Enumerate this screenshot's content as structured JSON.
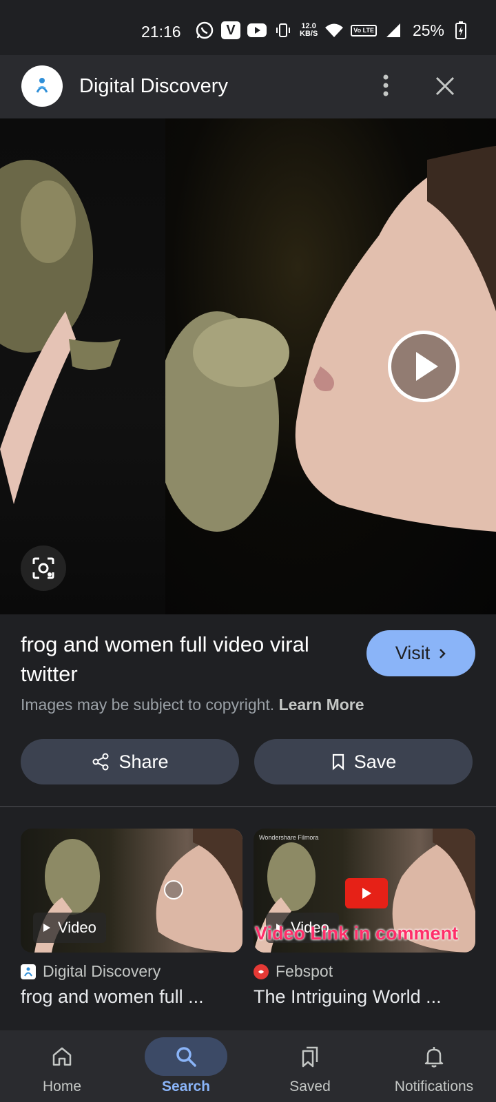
{
  "status_bar": {
    "time": "21:16",
    "net_speed_value": "12.0",
    "net_speed_unit": "KB/S",
    "volte": "Vo LTE",
    "battery": "25%"
  },
  "header": {
    "site_name": "Digital Discovery"
  },
  "details": {
    "title": "frog and women full video viral twitter",
    "visit_label": "Visit",
    "copyright_text": "Images may be subject to copyright.",
    "learn_more": "Learn More",
    "share_label": "Share",
    "save_label": "Save"
  },
  "related": [
    {
      "chip": "Video",
      "source": "Digital Discovery",
      "title": "frog and women full ..."
    },
    {
      "chip": "Video",
      "watermark": "Wondershare Filmora",
      "overlay": "Video Link in comment",
      "source": "Febspot",
      "title": "The Intriguing World ..."
    }
  ],
  "bottom_nav": [
    {
      "label": "Home",
      "icon": "home-icon"
    },
    {
      "label": "Search",
      "icon": "search-icon",
      "active": true
    },
    {
      "label": "Saved",
      "icon": "bookmarks-icon"
    },
    {
      "label": "Notifications",
      "icon": "bell-icon"
    }
  ],
  "colors": {
    "background": "#1f2023",
    "accent": "#8ab4f8",
    "button": "#3c4250"
  }
}
